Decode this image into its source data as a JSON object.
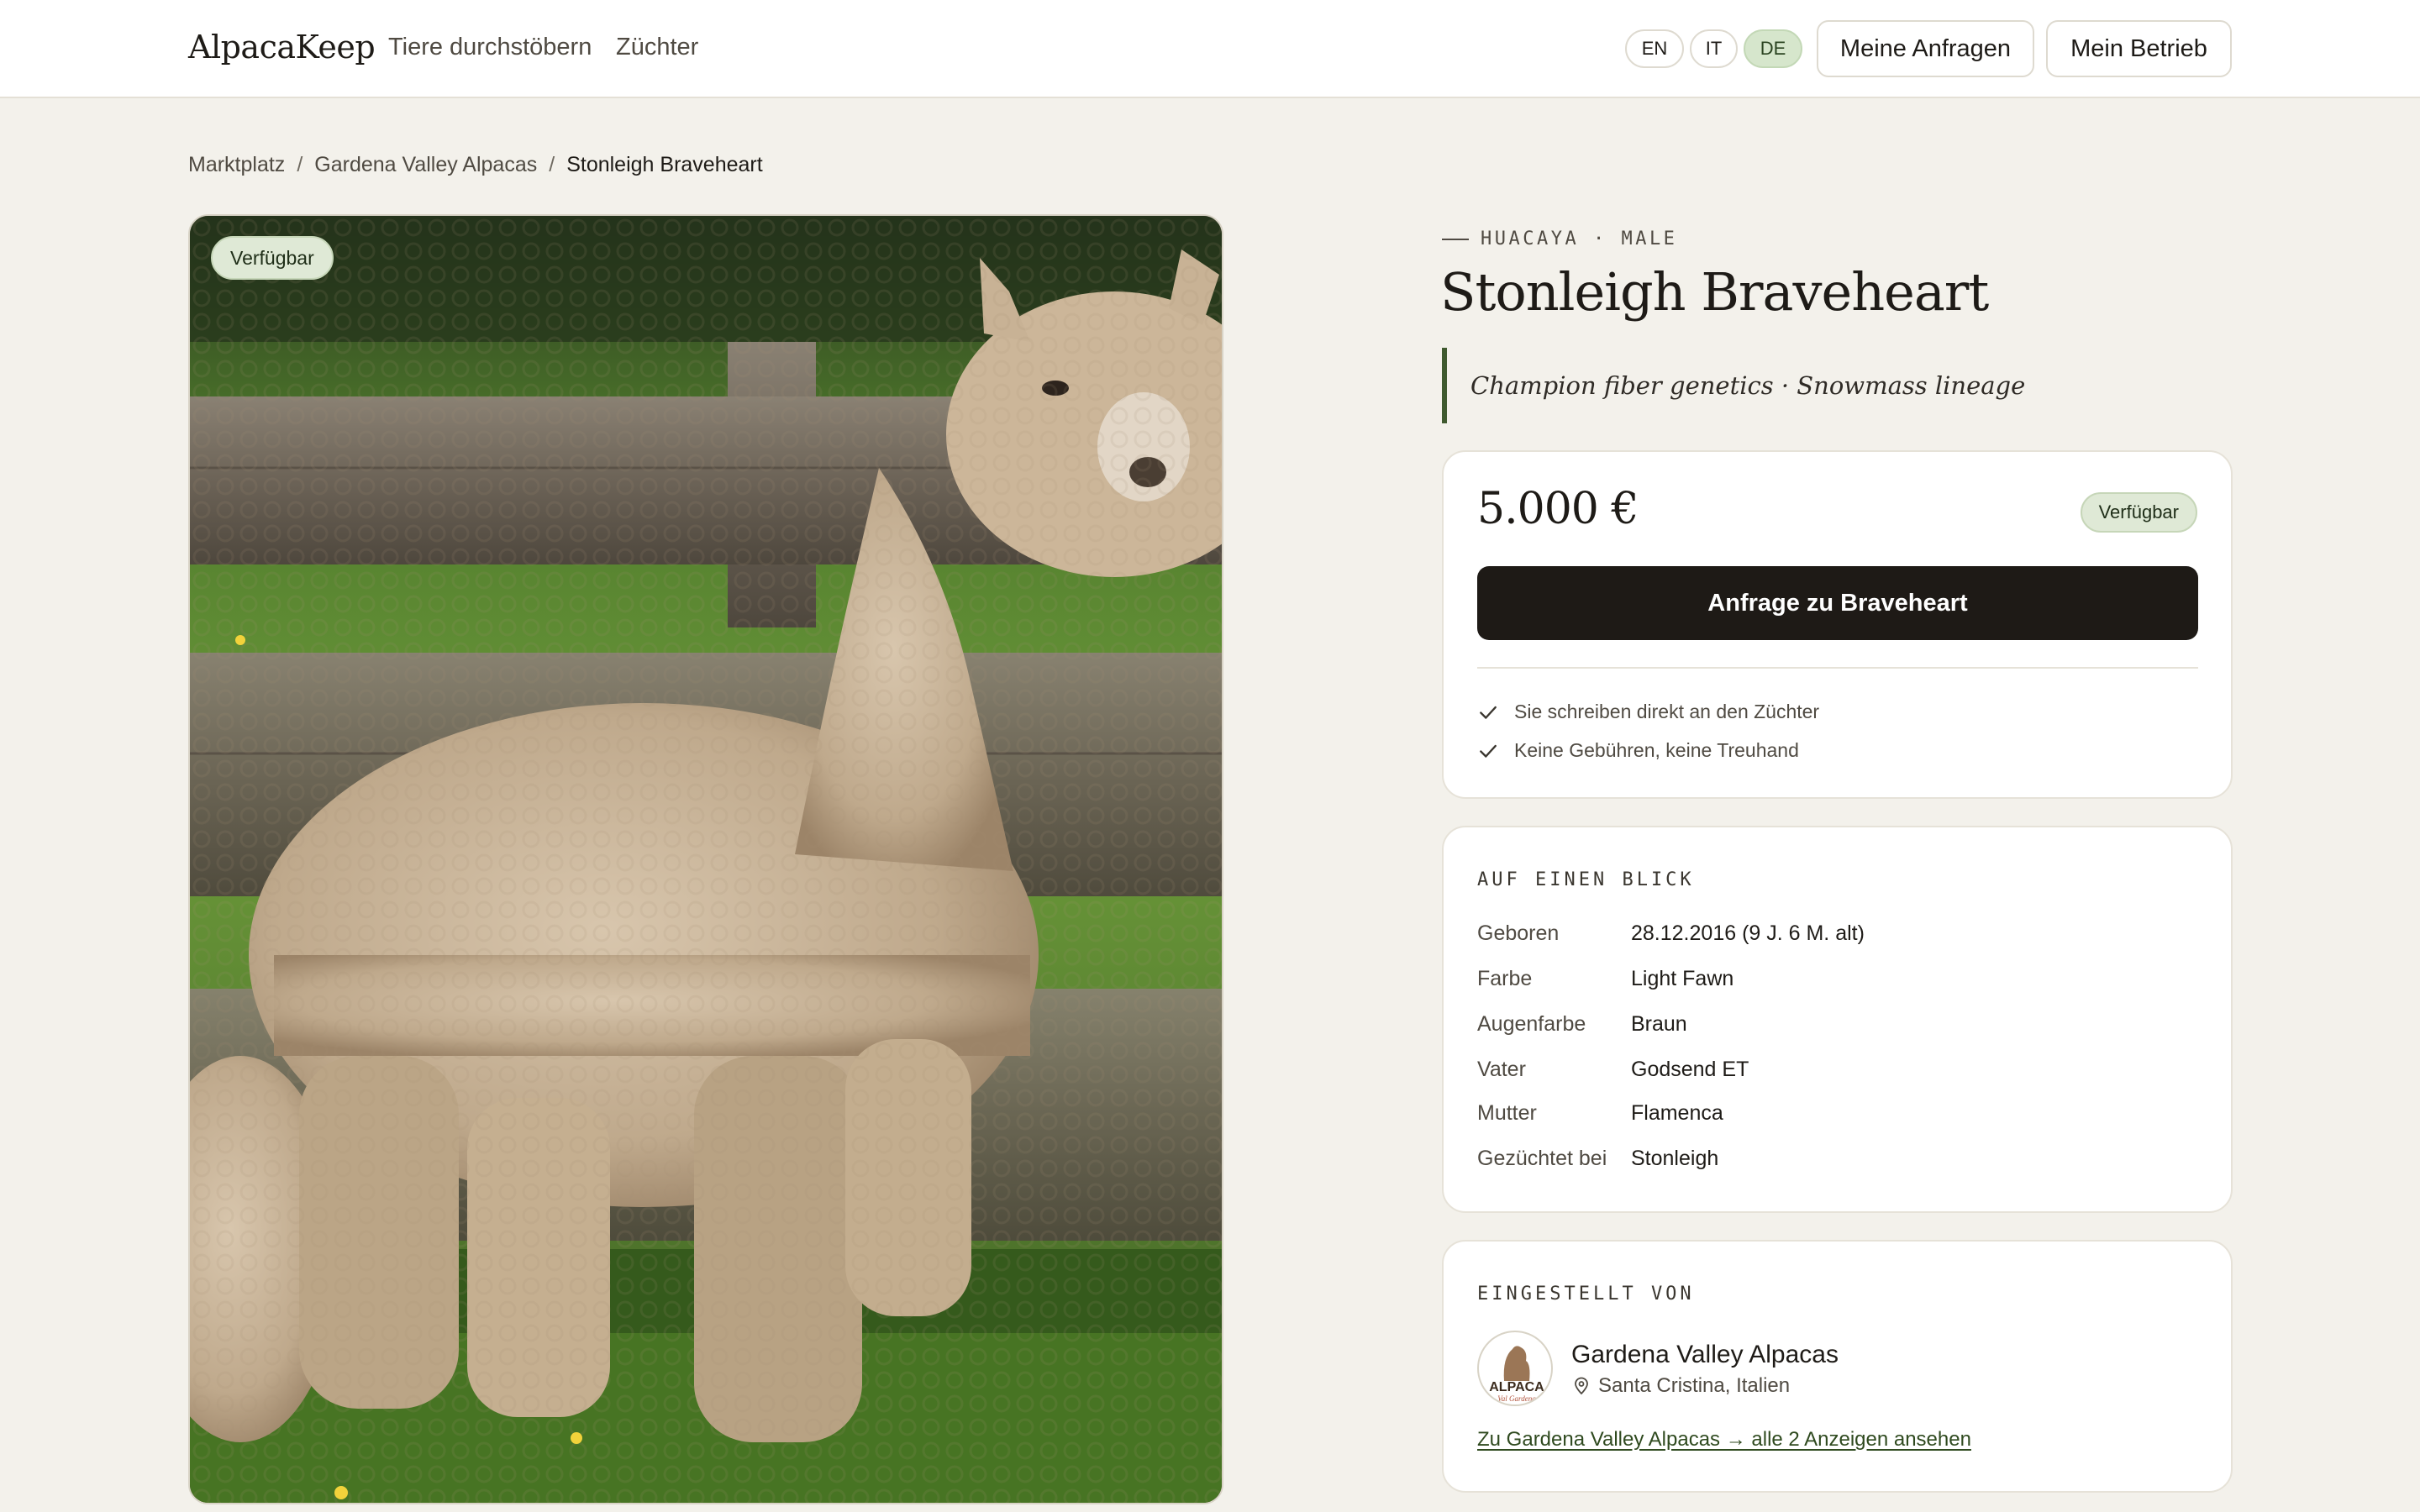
{
  "header": {
    "logo": "AlpacaKeep",
    "nav": [
      "Tiere durchstöbern",
      "Züchter"
    ],
    "languages": [
      "EN",
      "IT",
      "DE"
    ],
    "active_language": "DE",
    "buttons": [
      "Meine Anfragen",
      "Mein Betrieb"
    ]
  },
  "breadcrumb": [
    "Marktplatz",
    "Gardena Valley Alpacas",
    "Stonleigh Braveheart"
  ],
  "photo": {
    "badge": "Verfügbar"
  },
  "listing": {
    "eyebrow": "HUACAYA · MALE",
    "title": "Stonleigh Braveheart",
    "tagline": "Champion fiber genetics · Snowmass lineage"
  },
  "price_card": {
    "price": "5.000 €",
    "status": "Verfügbar",
    "cta": "Anfrage zu Braveheart",
    "checks": [
      "Sie schreiben direkt an den Züchter",
      "Keine Gebühren, keine Treuhand"
    ]
  },
  "glance": {
    "label": "AUF EINEN BLICK",
    "rows": [
      {
        "k": "Geboren",
        "v": "28.12.2016 (9 J. 6 M. alt)"
      },
      {
        "k": "Farbe",
        "v": "Light Fawn"
      },
      {
        "k": "Augenfarbe",
        "v": "Braun"
      },
      {
        "k": "Vater",
        "v": "Godsend ET"
      },
      {
        "k": "Mutter",
        "v": "Flamenca"
      },
      {
        "k": "Gezüchtet bei",
        "v": "Stonleigh"
      }
    ]
  },
  "seller": {
    "label": "EINGESTELLT VON",
    "name": "Gardena Valley Alpacas",
    "location": "Santa Cristina, Italien",
    "link": "Zu Gardena Valley Alpacas → alle 2 Anzeigen ansehen",
    "logo_text": "ALPACA",
    "logo_subtext": "Val Gardena"
  },
  "colors": {
    "background": "#f3f1eb",
    "accent_green": "#3f5a2f",
    "badge_green": "#dfe9d6",
    "cta_dark": "#1e1a16"
  }
}
